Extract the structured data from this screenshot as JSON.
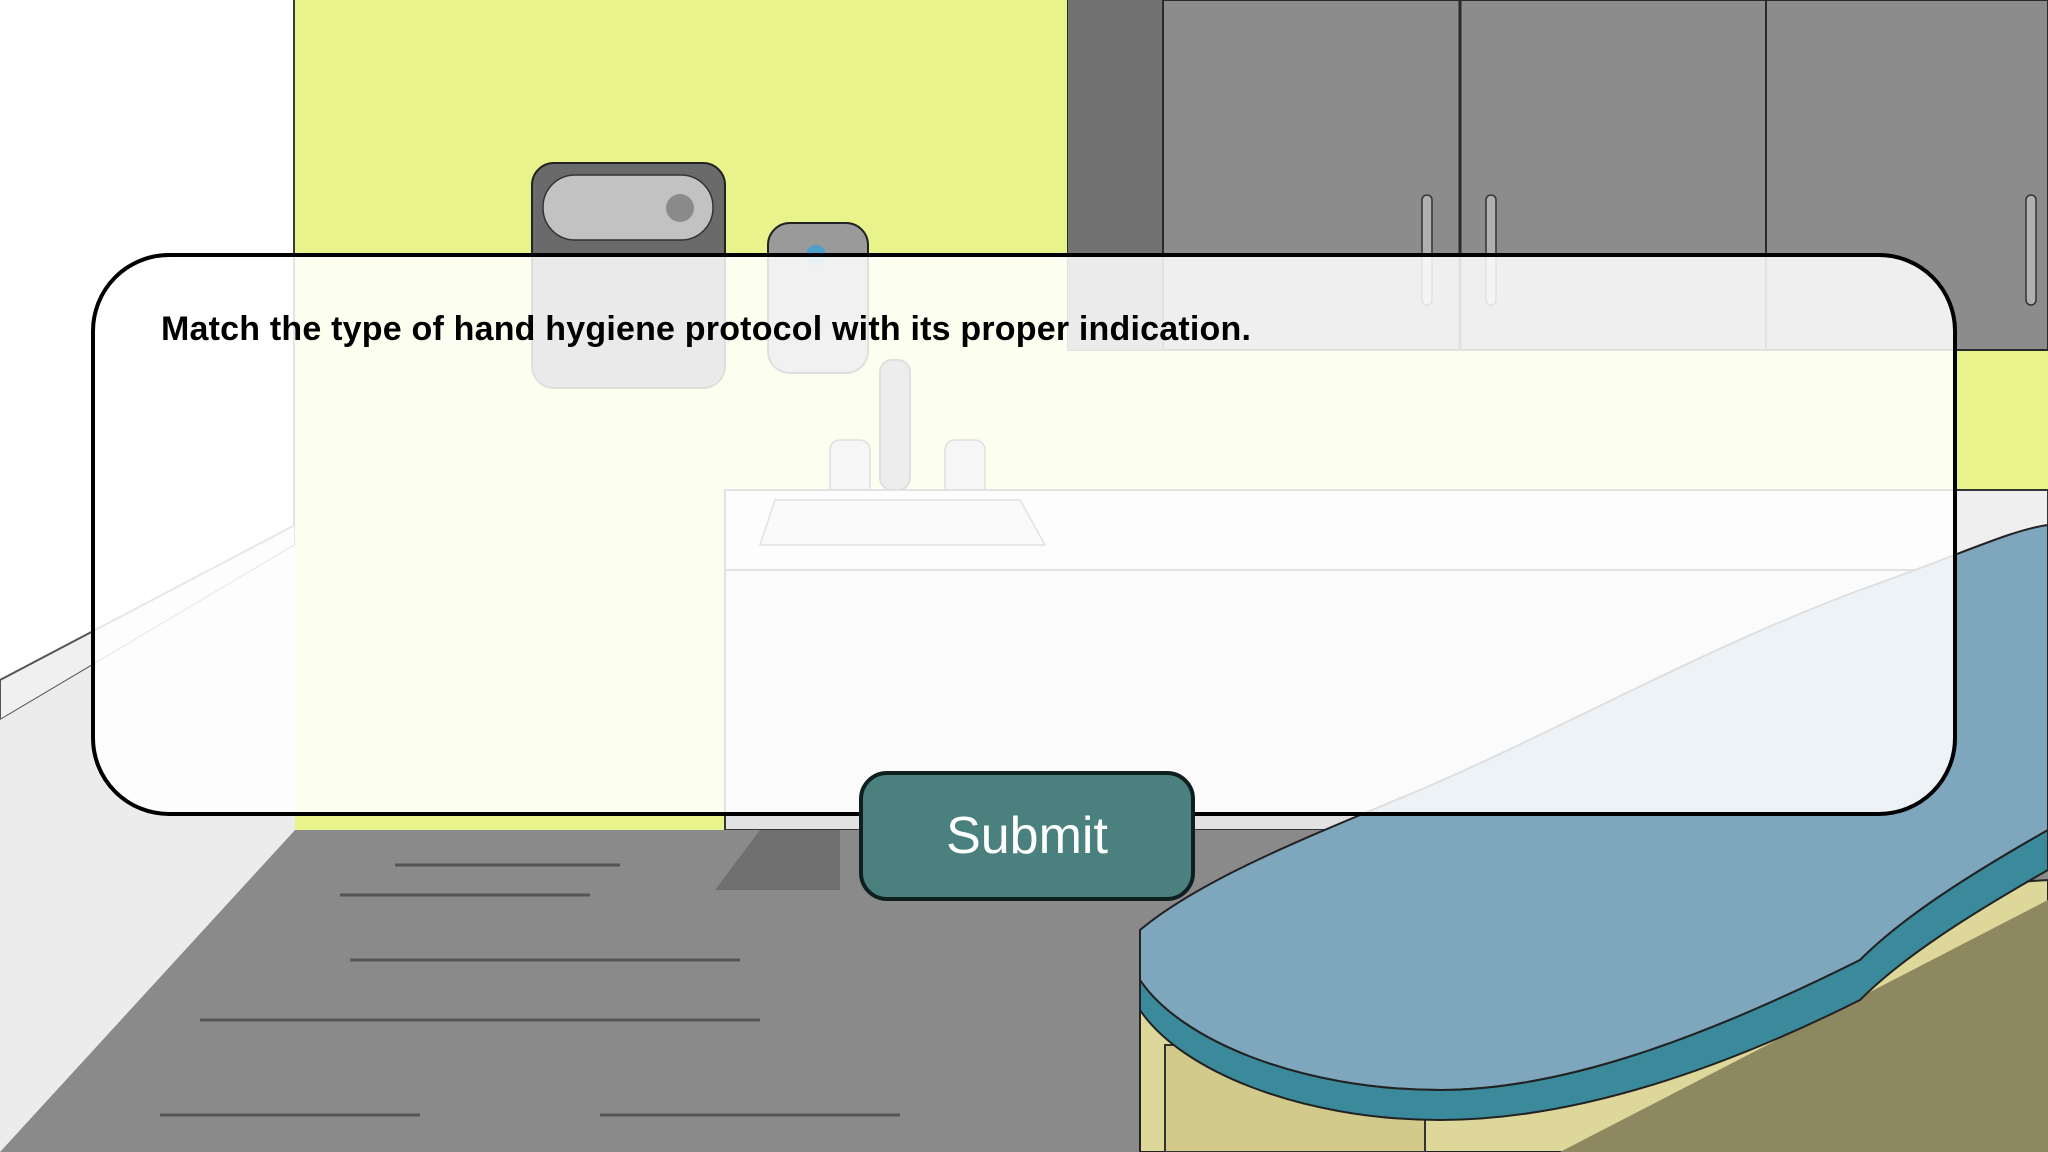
{
  "scene": {
    "name": "exam-room",
    "colors": {
      "wall": "#e9f38c",
      "floor": "#8a8a8a",
      "cabinet": "#8c8c8c",
      "exam_table_pad": "#7ea6bd",
      "exam_table_base": "#ded79a",
      "submit": "#4a807d"
    },
    "icons": [
      "paper-towel-dispenser-icon",
      "soap-dispenser-icon",
      "sink-faucet-icon",
      "exam-table-icon",
      "cabinet-icon"
    ]
  },
  "question": {
    "prompt": "Match the type of hand hygiene protocol with its proper indication."
  },
  "actions": {
    "submit_label": "Submit"
  }
}
